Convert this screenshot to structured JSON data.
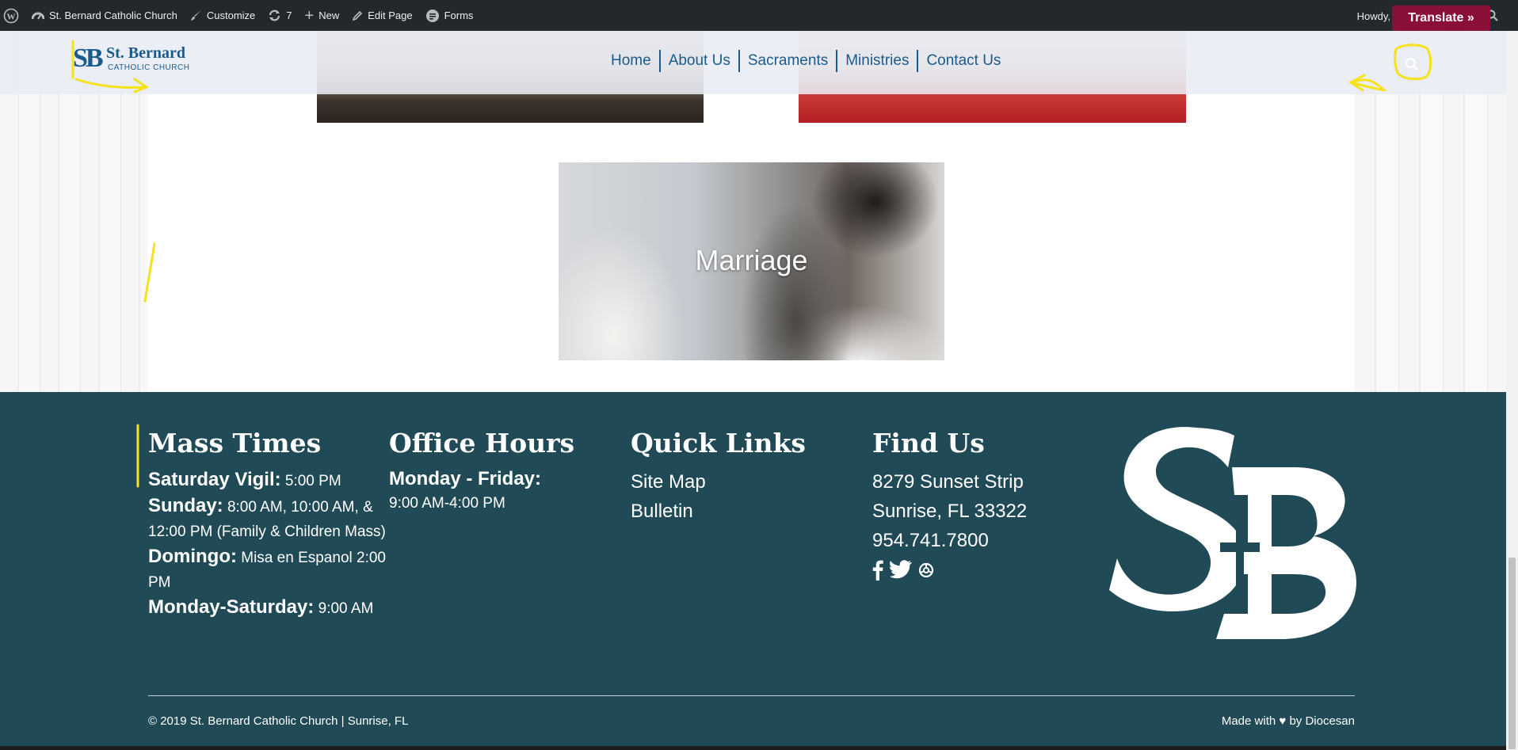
{
  "admin_bar": {
    "site_name": "St. Bernard Catholic Church",
    "customize": "Customize",
    "updates_count": "7",
    "new": "New",
    "edit_page": "Edit Page",
    "forms": "Forms",
    "howdy": "Howdy, dio",
    "translate": "Translate »"
  },
  "header": {
    "logo_mark": "SB",
    "logo_name": "St. Bernard",
    "logo_sub": "CATHOLIC CHURCH",
    "nav": [
      "Home",
      "About Us",
      "Sacraments",
      "Ministries",
      "Contact Us"
    ]
  },
  "content": {
    "tile_marriage": "Marriage"
  },
  "footer": {
    "mass": {
      "title": "Mass Times",
      "lines": [
        {
          "day": "Saturday Vigil:",
          "time": " 5:00 PM"
        },
        {
          "day": "Sunday:",
          "time": " 8:00 AM, 10:00 AM, & 12:00 PM (Family & Children Mass)"
        },
        {
          "day": "Domingo:",
          "time": " Misa en Espanol 2:00 PM"
        },
        {
          "day": "Monday-Saturday:",
          "time": " 9:00 AM"
        }
      ]
    },
    "office": {
      "title": "Office Hours",
      "day": "Monday - Friday:",
      "time": "9:00 AM-4:00 PM"
    },
    "links": {
      "title": "Quick Links",
      "items": [
        "Site Map",
        "Bulletin"
      ]
    },
    "find": {
      "title": "Find Us",
      "address1": "8279 Sunset Strip",
      "address2": "Sunrise, FL 33322",
      "phone": "954.741.7800",
      "social": [
        "facebook-icon",
        "twitter-icon",
        "flickr-icon"
      ]
    },
    "copyright": "© 2019 St. Bernard Catholic Church | Sunrise, FL",
    "made_with": "Made with ♥ by Diocesan"
  },
  "colors": {
    "admin_bar": "#23282d",
    "brand_blue": "#1a5b8c",
    "footer_bg": "#214a57",
    "translate_bg": "#8a0f36",
    "annotation_yellow": "#f5e11c"
  }
}
